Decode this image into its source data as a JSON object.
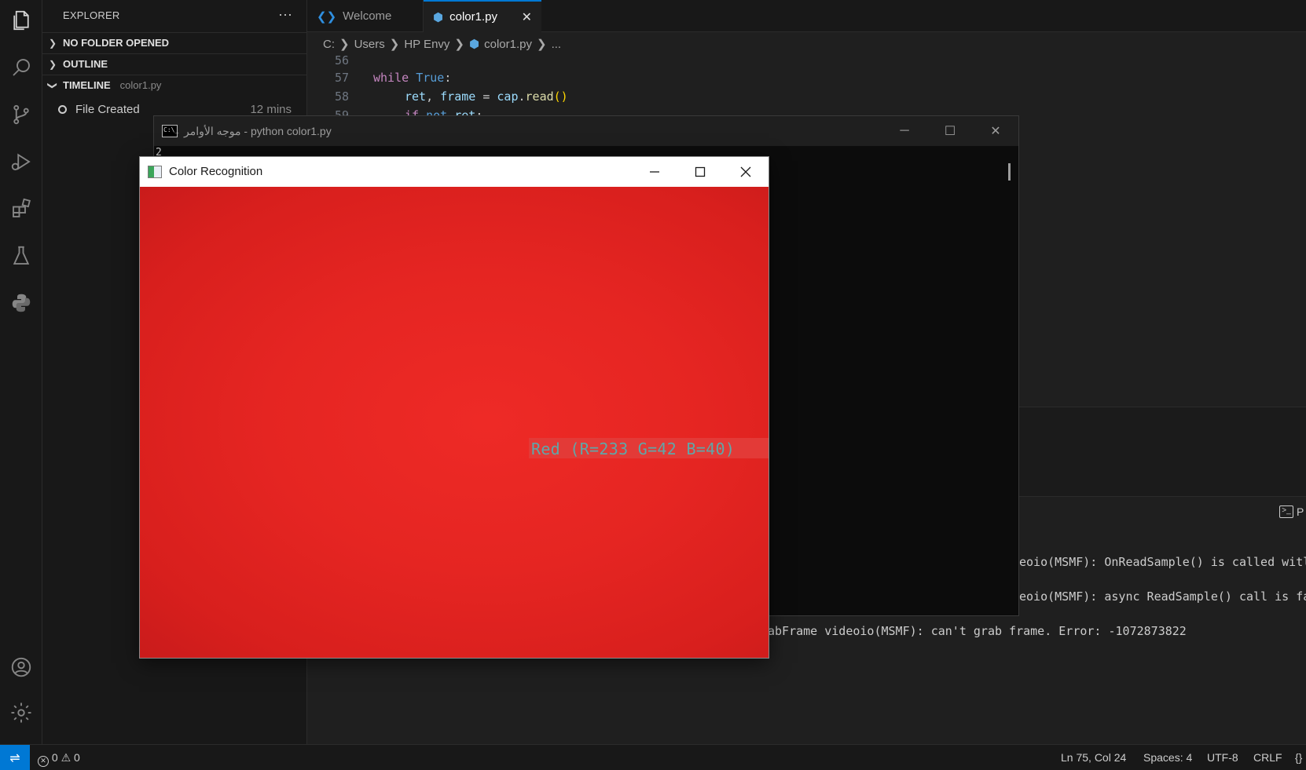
{
  "sidebar": {
    "title": "EXPLORER",
    "more": "···",
    "sections": [
      {
        "label": "NO FOLDER OPENED",
        "sub": ""
      },
      {
        "label": "OUTLINE",
        "sub": ""
      },
      {
        "label": "TIMELINE",
        "sub": "color1.py"
      }
    ],
    "timeline_item": {
      "label": "File Created",
      "time": "12 mins"
    }
  },
  "tabs": [
    {
      "label": "Welcome",
      "icon": "vscode-icon"
    },
    {
      "label": "color1.py",
      "icon": "python-file-icon",
      "close": "✕"
    }
  ],
  "breadcrumb": [
    "C:",
    "Users",
    "HP Envy",
    "color1.py",
    "..."
  ],
  "code": [
    {
      "ln": "56"
    },
    {
      "ln": "57"
    },
    {
      "ln": "58"
    },
    {
      "ln": "59"
    }
  ],
  "code_text": {
    "while": "while",
    "true": "True",
    "colon": ":",
    "ret": "ret",
    "comma": ", ",
    "frame": "frame",
    "eq": " = ",
    "cap": "cap",
    "dot": ".",
    "read": "read",
    "parens": "()",
    "if": "if",
    "not": "not",
    "ret2": "ret",
    "colon2": ":"
  },
  "cmd_window": {
    "title": "موجه الأوامر - python  color1.py",
    "output": "2",
    "icon_text": "C:\\_",
    "minimize": "─",
    "maximize": "☐",
    "close": "✕"
  },
  "cr_window": {
    "title": "Color Recognition",
    "label": "Red (R=233 G=42 B=40)",
    "frame_color": "#e52522"
  },
  "terminal": {
    "lines": [
      "eoio(MSMF): OnReadSample() is called witl",
      "eoio(MSMF): async ReadSample() call is fa",
      "abFrame videoio(MSMF): can't grab frame. Error: -1072873822"
    ],
    "tab_label": "P"
  },
  "statusbar": {
    "errors": "0",
    "warnings": "0",
    "position": "Ln 75, Col 24",
    "spaces": "Spaces: 4",
    "encoding": "UTF-8",
    "eol": "CRLF",
    "lang": "{}"
  },
  "colors": {
    "accent": "#0078d4",
    "editor_bg": "#1f1f1f",
    "sidebar_bg": "#181818"
  }
}
